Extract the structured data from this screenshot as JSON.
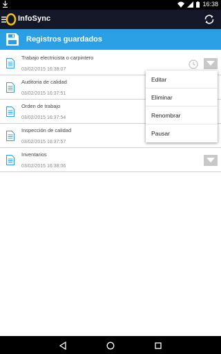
{
  "status_bar": {
    "time": "16:38",
    "icons": [
      "download-icon",
      "wifi-icon",
      "signal-icon",
      "battery-icon"
    ]
  },
  "app_bar": {
    "title": "InfoSync",
    "icons": [
      "menu-icon",
      "app-logo",
      "sync-icon"
    ]
  },
  "section": {
    "title": "Registros guardados",
    "icon": "save-icon"
  },
  "records": [
    {
      "title": "Trabajo electricista o carpintero",
      "date": "03/02/2015 16:38:07"
    },
    {
      "title": "Auditoria de calidad",
      "date": "03/02/2015 16:37:51"
    },
    {
      "title": "Orden de trabajo",
      "date": "03/02/2015 16:37:54"
    },
    {
      "title": "Inspección de calidad",
      "date": "03/02/2015 16:37:57"
    },
    {
      "title": "Inventarios",
      "date": "03/02/2015 16:38:06"
    }
  ],
  "context_menu": {
    "items": [
      "Editar",
      "Eliminar",
      "Renombrar",
      "Pausar"
    ]
  },
  "nav_bar": {
    "icons": [
      "back-icon",
      "home-icon",
      "recents-icon"
    ]
  },
  "colors": {
    "app_bar": "#141728",
    "header": "#2a9fe3",
    "logo": "#f5c400",
    "dropdown": "#c8c8c8"
  }
}
